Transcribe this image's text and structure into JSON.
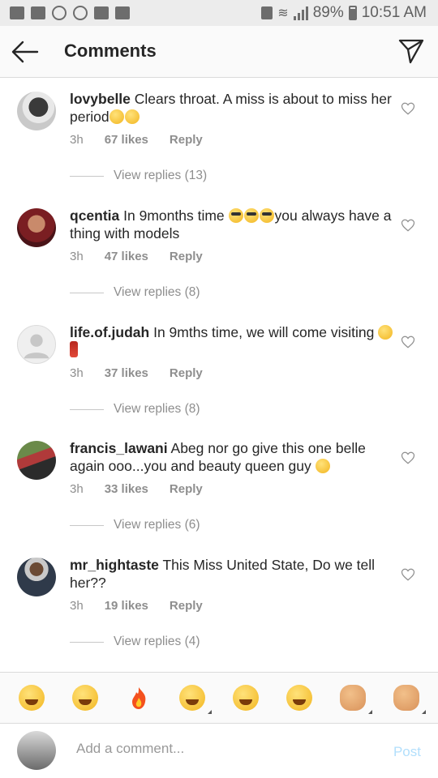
{
  "status_bar": {
    "battery": "89%",
    "time": "10:51 AM"
  },
  "header": {
    "title": "Comments"
  },
  "comments": [
    {
      "username": "lovybelle",
      "text": "Clears throat. A miss is about to miss her period",
      "emoji": "rofl-emoji",
      "time": "3h",
      "likes": "67 likes",
      "reply": "Reply",
      "view_replies": "View replies (13)"
    },
    {
      "username": "qcentia",
      "text_before": "In 9months time ",
      "emoji": "sunglasses-emoji",
      "text_after": "you always have a thing with models",
      "time": "3h",
      "likes": "47 likes",
      "reply": "Reply",
      "view_replies": "View replies (8)"
    },
    {
      "username": "life.of.judah",
      "text": "In 9mths time, we will come visiting ",
      "emoji": "relieved-emoji",
      "time": "3h",
      "likes": "37 likes",
      "reply": "Reply",
      "view_replies": "View replies (8)"
    },
    {
      "username": "francis_lawani",
      "text": "Abeg nor go give this one belle again ooo...you and beauty queen guy ",
      "emoji": "laughing-emoji",
      "time": "3h",
      "likes": "33 likes",
      "reply": "Reply",
      "view_replies": "View replies (6)"
    },
    {
      "username": "mr_hightaste",
      "text": "This Miss United State, Do we tell her??",
      "time": "3h",
      "likes": "19 likes",
      "reply": "Reply",
      "view_replies": "View replies (4)"
    }
  ],
  "emoji_bar": [
    "rofl",
    "joy",
    "fire",
    "kiss-face",
    "grin",
    "astonished",
    "fist",
    "ok-hand"
  ],
  "input": {
    "placeholder": "Add a comment...",
    "post_label": "Post"
  },
  "colors": {
    "username": "#262626",
    "meta": "#8e8e8e",
    "post": "#b2dffc",
    "divider": "#dbdbdb"
  }
}
